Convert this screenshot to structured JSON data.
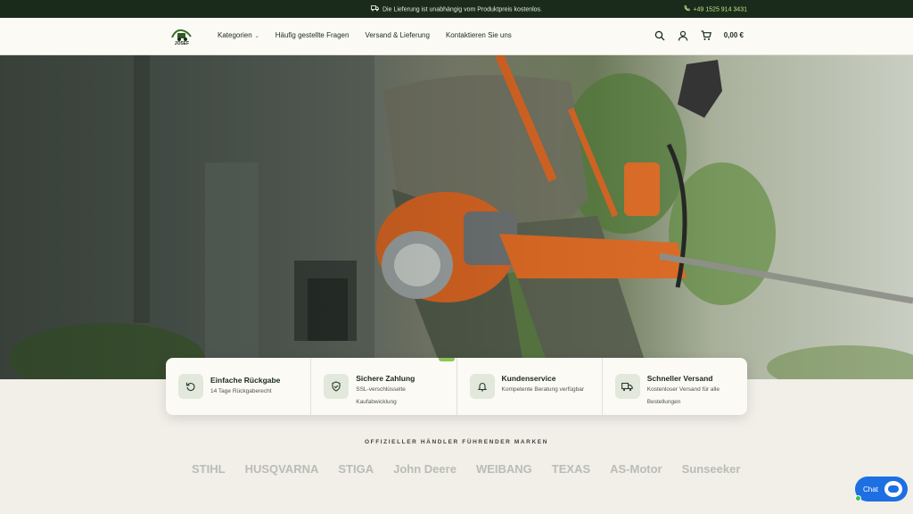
{
  "topbar": {
    "shipping_message": "Die Lieferung ist unabhängig vom Produktpreis kostenlos.",
    "phone": "+49 1525 914 3431",
    "truck_icon": "truck-icon",
    "phone_icon": "phone-icon"
  },
  "header": {
    "logo_text": "JOSEF",
    "nav": [
      {
        "label": "Kategorien",
        "icon": "chevron-down-icon"
      },
      {
        "label": "Häufig gestellte Fragen"
      },
      {
        "label": "Versand & Lieferung"
      },
      {
        "label": "Kontaktieren Sie uns"
      }
    ],
    "icons": [
      "search-icon",
      "user-icon",
      "cart-icon"
    ],
    "cart_total": "0,00 €"
  },
  "features": [
    {
      "title": "Einfache Rückgabe",
      "subtitle": "14 Tage Rückgaberecht",
      "icon": "return-icon"
    },
    {
      "title": "Sichere Zahlung",
      "subtitle": "SSL-verschlüsselte Kaufabwicklung",
      "icon": "shield-icon"
    },
    {
      "title": "Kundenservice",
      "subtitle": "Kompetente Beratung verfügbar",
      "icon": "bell-icon"
    },
    {
      "title": "Schneller Versand",
      "subtitle": "Kostenloser Versand für alle Bestellungen",
      "icon": "truck-icon"
    }
  ],
  "brands": {
    "title": "OFFIZIELLER HÄNDLER FÜHRENDER MARKEN",
    "items": [
      "STIHL",
      "HUSQVARNA",
      "STIGA",
      "John Deere",
      "WEIBANG",
      "TEXAS",
      "AS-Motor",
      "Sunseeker"
    ]
  },
  "chat": {
    "label": "Chat"
  },
  "colors": {
    "dark_green": "#1a2b1c",
    "accent_green": "#8ac65a",
    "chat_blue": "#1e6fe3",
    "tool_orange": "#d8621f"
  }
}
